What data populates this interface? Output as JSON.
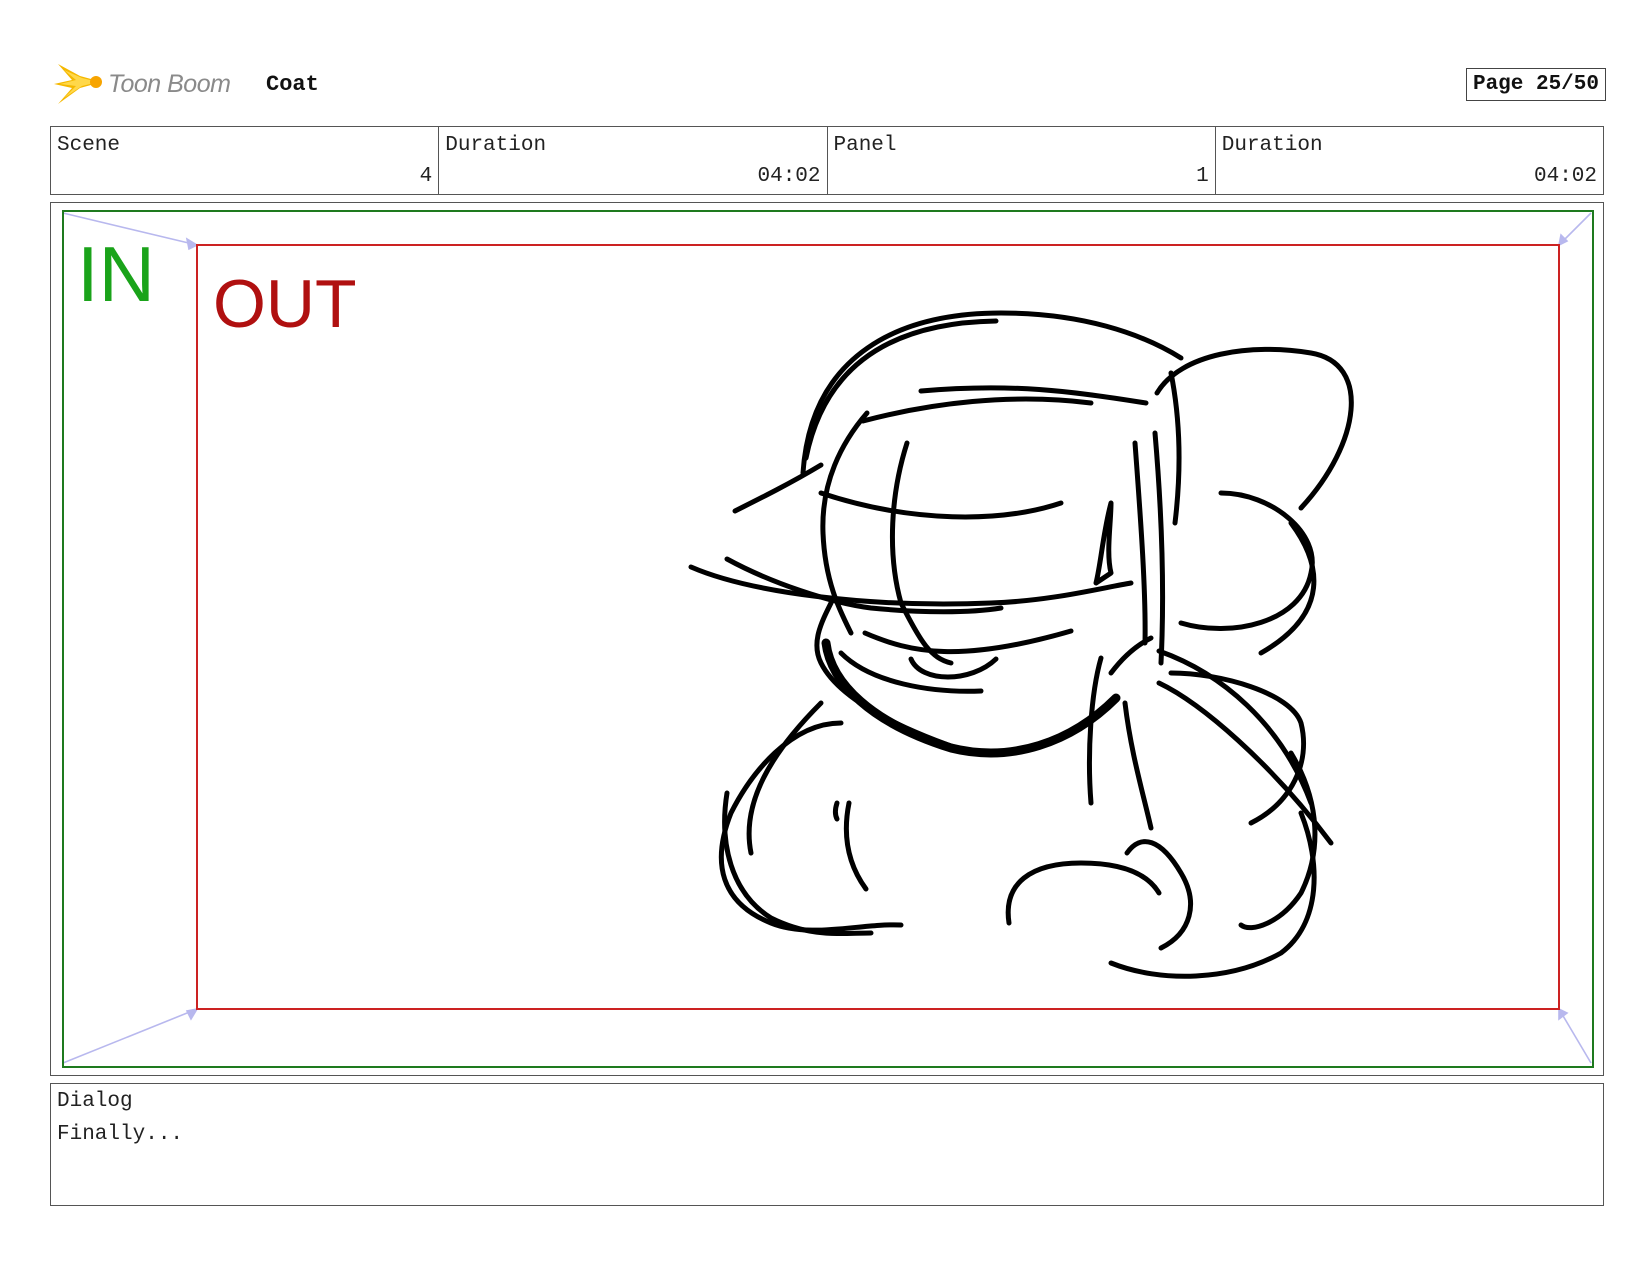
{
  "header": {
    "logo_text": "Toon Boom",
    "project_title": "Coat",
    "page": "Page 25/50"
  },
  "info": {
    "scene_label": "Scene",
    "scene_value": "4",
    "scene_duration_label": "Duration",
    "scene_duration_value": "04:02",
    "panel_label": "Panel",
    "panel_value": "1",
    "panel_duration_label": "Duration",
    "panel_duration_value": "04:02"
  },
  "panel": {
    "in_label": "IN",
    "out_label": "OUT",
    "in_color": "#1aa31a",
    "out_color": "#b01010",
    "in_frame_color": "#1e7a1e",
    "out_frame_color": "#cc2222",
    "guide_color": "#b8b8ee"
  },
  "dialog": {
    "label": "Dialog",
    "text": "Finally..."
  }
}
